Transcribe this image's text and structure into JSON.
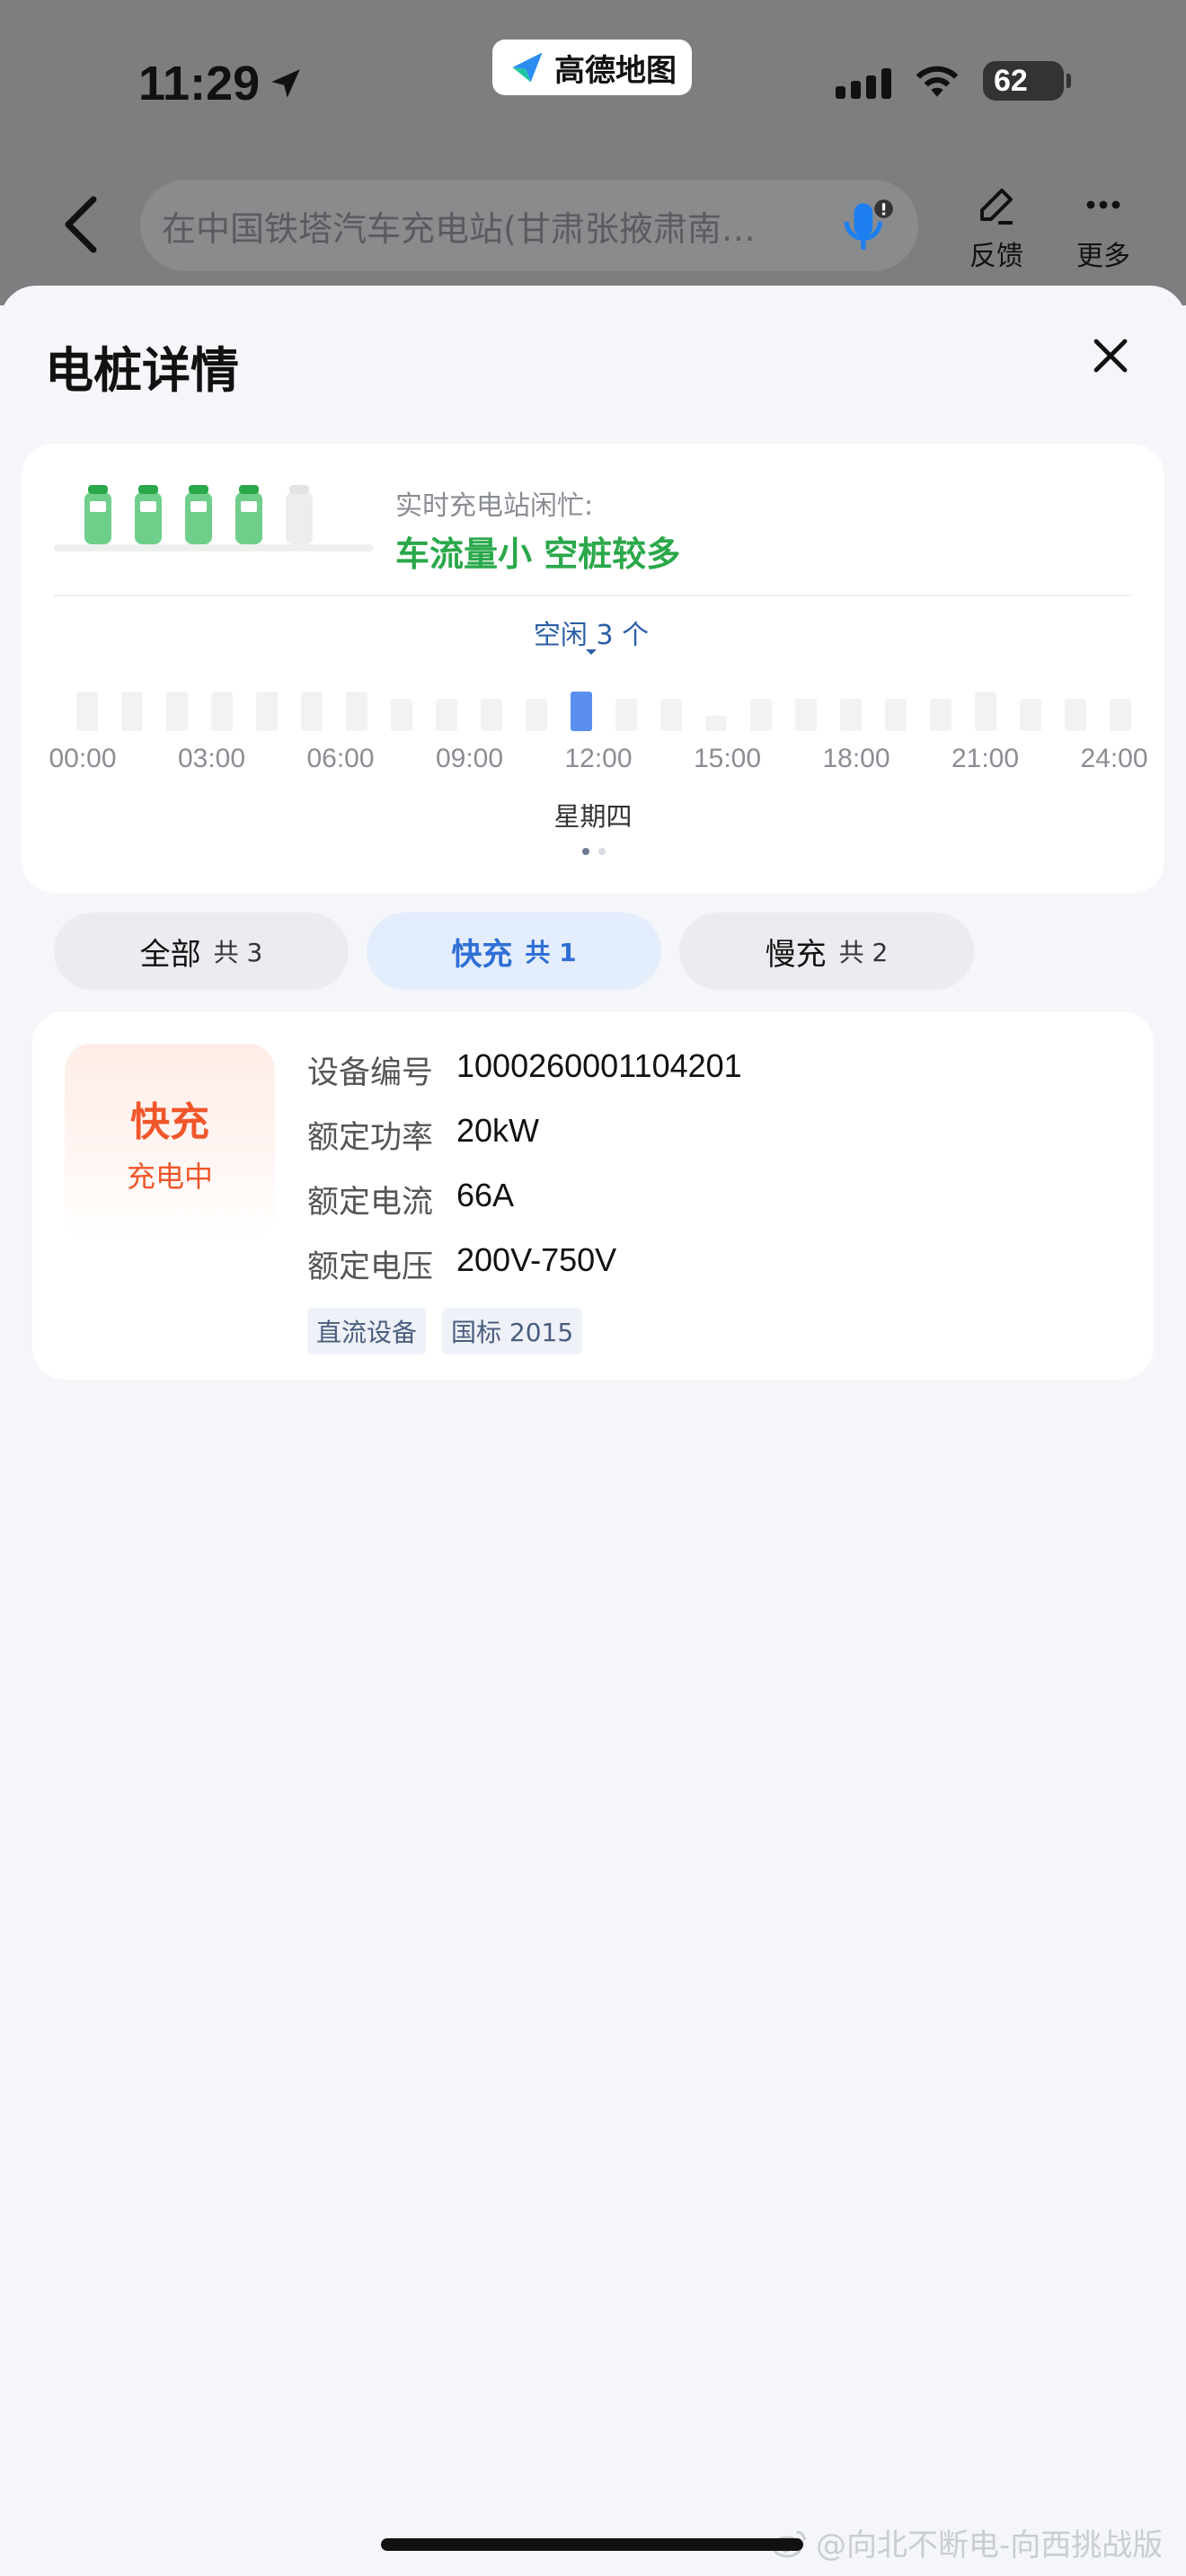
{
  "status_bar": {
    "time": "11:29",
    "app_name": "高德地图",
    "battery": "62"
  },
  "header": {
    "search_text": "在中国铁塔汽车充电站(甘肃张掖肃南…",
    "feedback_label": "反馈",
    "more_label": "更多"
  },
  "sheet": {
    "title": "电桩详情"
  },
  "busy": {
    "label": "实时充电站闲忙:",
    "status": "车流量小 空桩较多",
    "highlight_tooltip": "空闲 3 个",
    "hour_labels": [
      "00:00",
      "03:00",
      "06:00",
      "09:00",
      "12:00",
      "15:00",
      "18:00",
      "21:00",
      "24:00"
    ],
    "weekday": "星期四",
    "current_index": 11,
    "bar_levels": [
      0.55,
      0.55,
      0.55,
      0.55,
      0.55,
      0.55,
      0.55,
      0.45,
      0.45,
      0.45,
      0.45,
      0.55,
      0.45,
      0.45,
      0.22,
      0.45,
      0.45,
      0.45,
      0.45,
      0.45,
      0.55,
      0.45,
      0.45,
      0.45
    ],
    "colors": {
      "status": "#2aa84a",
      "current_bar": "#5a8ff0",
      "bar": "#f1f2f4"
    }
  },
  "tabs": [
    {
      "label": "全部",
      "count": "共 3",
      "active": false
    },
    {
      "label": "快充",
      "count": "共 1",
      "active": true
    },
    {
      "label": "慢充",
      "count": "共 2",
      "active": false
    }
  ],
  "pile": {
    "type": "快充",
    "state": "充电中",
    "specs": [
      {
        "key": "设备编号",
        "value": "1000260001104201"
      },
      {
        "key": "额定功率",
        "value": "20kW"
      },
      {
        "key": "额定电流",
        "value": "66A"
      },
      {
        "key": "额定电压",
        "value": "200V-750V"
      }
    ],
    "tags": [
      "直流设备",
      "国标 2015"
    ]
  },
  "watermark": "@向北不断电-向西挑战版"
}
